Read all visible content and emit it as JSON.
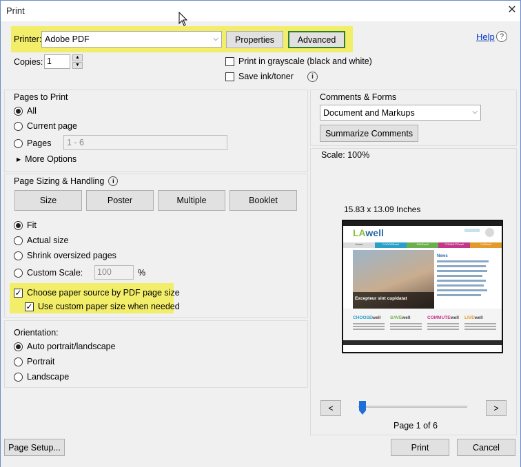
{
  "window": {
    "title": "Print",
    "close_glyph": "✕"
  },
  "printer": {
    "label": "Printer:",
    "selected": "Adobe PDF",
    "properties_label": "Properties",
    "advanced_label": "Advanced",
    "help_label": "Help",
    "copies_label": "Copies:",
    "copies_value": "1",
    "grayscale_label": "Print in grayscale (black and white)",
    "grayscale_checked": false,
    "save_ink_label": "Save ink/toner",
    "save_ink_checked": false
  },
  "pages_to_print": {
    "title": "Pages to Print",
    "options": [
      {
        "label": "All",
        "selected": true
      },
      {
        "label": "Current page",
        "selected": false
      },
      {
        "label": "Pages",
        "selected": false
      }
    ],
    "pages_range_placeholder": "1 - 6",
    "more_options_label": "More Options"
  },
  "sizing": {
    "title": "Page Sizing & Handling",
    "buttons": [
      "Size",
      "Poster",
      "Multiple",
      "Booklet"
    ],
    "options": [
      {
        "label": "Fit",
        "selected": true
      },
      {
        "label": "Actual size",
        "selected": false
      },
      {
        "label": "Shrink oversized pages",
        "selected": false
      },
      {
        "label": "Custom Scale:",
        "selected": false
      }
    ],
    "custom_scale_value": "100",
    "percent_symbol": "%",
    "paper_source_label": "Choose paper source by PDF page size",
    "paper_source_checked": true,
    "custom_paper_label": "Use custom paper size when needed",
    "custom_paper_checked": true
  },
  "orientation": {
    "title": "Orientation:",
    "options": [
      {
        "label": "Auto portrait/landscape",
        "selected": true
      },
      {
        "label": "Portrait",
        "selected": false
      },
      {
        "label": "Landscape",
        "selected": false
      }
    ]
  },
  "comments": {
    "title": "Comments & Forms",
    "selected": "Document and Markups",
    "summarize_label": "Summarize Comments"
  },
  "preview": {
    "scale_text": "Scale: 100%",
    "dimensions_text": "15.83 x 13.09 Inches",
    "prev_label": "<",
    "next_label": ">",
    "page_indicator": "Page 1 of 6",
    "page_position": 0,
    "doc": {
      "logo_prefix": "LA",
      "logo_suffix": "well",
      "nav": [
        "Home",
        "CHOOSEwell",
        "SAVEwell",
        "COMMUTEwell",
        "LIVEwell"
      ],
      "news_title": "News",
      "hero_caption": "Excepteur sint cupidatat",
      "footer_items": [
        {
          "pre": "CHOOSE",
          "post": "well",
          "color": "#2aa0c9"
        },
        {
          "pre": "SAVE",
          "post": "well",
          "color": "#6ab04c"
        },
        {
          "pre": "COMMUTE",
          "post": "well",
          "color": "#c2378a"
        },
        {
          "pre": "LIVE",
          "post": "well",
          "color": "#e29a2d"
        }
      ]
    }
  },
  "footer": {
    "page_setup_label": "Page Setup...",
    "print_label": "Print",
    "cancel_label": "Cancel"
  },
  "colors": {
    "highlight": "#f3ee6a",
    "focus_border": "#2c7d2c",
    "slider_thumb": "#1e6fd9"
  }
}
